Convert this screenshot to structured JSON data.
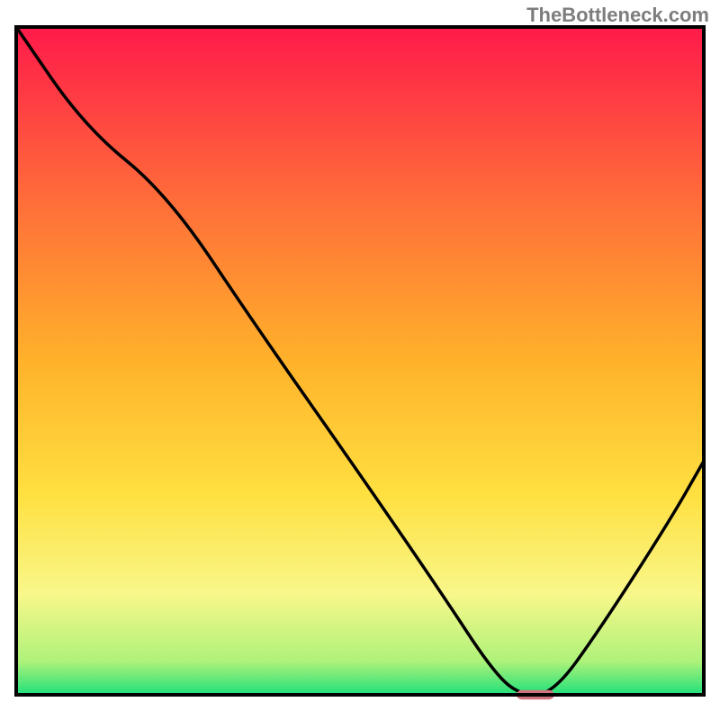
{
  "watermark": "TheBottleneck.com",
  "chart_data": {
    "type": "line",
    "title": "",
    "xlabel": "",
    "ylabel": "",
    "xlim": [
      0,
      100
    ],
    "ylim": [
      0,
      100
    ],
    "legend": false,
    "grid": false,
    "background": {
      "type": "vertical-gradient",
      "stops": [
        {
          "pos": 0.0,
          "color": "#ff1a4a"
        },
        {
          "pos": 0.25,
          "color": "#ff6a3a"
        },
        {
          "pos": 0.5,
          "color": "#ffb22a"
        },
        {
          "pos": 0.7,
          "color": "#ffe040"
        },
        {
          "pos": 0.85,
          "color": "#f8f78a"
        },
        {
          "pos": 0.95,
          "color": "#aef27a"
        },
        {
          "pos": 1.0,
          "color": "#1fe07a"
        }
      ]
    },
    "series": [
      {
        "name": "bottleneck-curve",
        "color": "#000000",
        "x": [
          0,
          10,
          22,
          35,
          50,
          62,
          69,
          73,
          78,
          85,
          95,
          100
        ],
        "y": [
          100,
          85,
          75,
          55,
          33,
          15,
          4,
          0,
          0,
          10,
          26,
          35
        ]
      }
    ],
    "marker": {
      "name": "optimal-point",
      "shape": "rounded-rect",
      "color": "#d0727e",
      "x": 75.5,
      "y": 0,
      "width": 5.5,
      "height": 1.4
    },
    "border": {
      "color": "#000000",
      "width": 4
    }
  }
}
